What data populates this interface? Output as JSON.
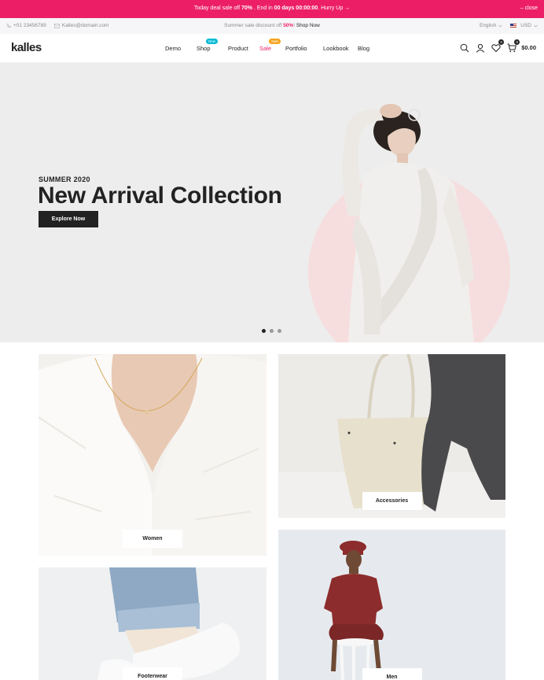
{
  "promo": {
    "text_pre": "Today deal sale off ",
    "text_pct": "70%",
    "text_mid": " . End in ",
    "text_timer": "00 days 00:00:00",
    "text_post": ". Hurry Up →",
    "close": "– close"
  },
  "topbar": {
    "phone": "+01 23456789",
    "email": "Kalles@domain.com",
    "center_pre": "Summer sale discount off ",
    "center_pct": "50%",
    "center_sep": "! ",
    "center_link": "Shop Now",
    "language": "English",
    "currency": "USD"
  },
  "header": {
    "logo": "kalles",
    "nav": [
      {
        "label": "Demo"
      },
      {
        "label": "Shop",
        "badge": "New"
      },
      {
        "label": "Product"
      },
      {
        "label": "Sale",
        "badge": "Sale"
      },
      {
        "label": "Portfolio"
      },
      {
        "label": "Lookbook"
      },
      {
        "label": "Blog"
      }
    ],
    "wishlist_count": "0",
    "cart_count": "0",
    "cart_total": "$0.00"
  },
  "hero": {
    "subtitle": "SUMMER 2020",
    "title": "New Arrival Collection",
    "button": "Explore Now"
  },
  "categories": {
    "women": "Women",
    "accessories": "Accessories",
    "footwear": "Footerwear",
    "men": "Men"
  },
  "colors": {
    "accent": "#ec1f66",
    "badge_new": "#01bad4",
    "badge_sale": "#f6a21b",
    "dark": "#222222"
  }
}
